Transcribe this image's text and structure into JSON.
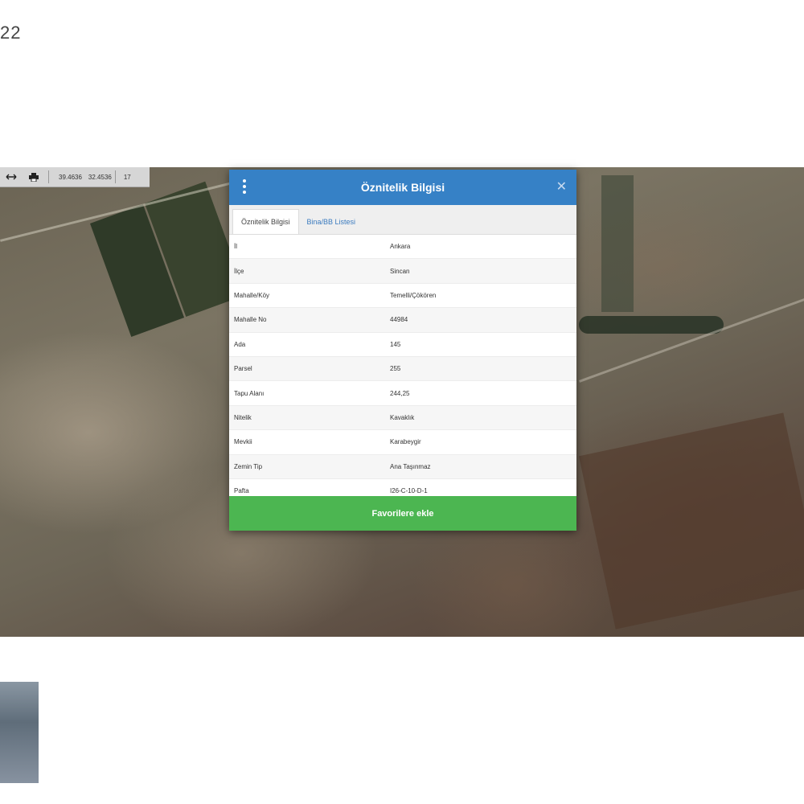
{
  "corner_label": "22",
  "toolbar": {
    "coord_1": "39.4636",
    "coord_2": "32.4536",
    "zoom": "17"
  },
  "dialog": {
    "title": "Öznitelik Bilgisi",
    "tabs": [
      {
        "label": "Öznitelik Bilgisi"
      },
      {
        "label": "Bina/BB Listesi"
      }
    ],
    "rows": [
      {
        "key": "İl",
        "value": "Ankara"
      },
      {
        "key": "İlçe",
        "value": "Sincan"
      },
      {
        "key": "Mahalle/Köy",
        "value": "Temelli/Çökören"
      },
      {
        "key": "Mahalle No",
        "value": "44984"
      },
      {
        "key": "Ada",
        "value": "145"
      },
      {
        "key": "Parsel",
        "value": "255"
      },
      {
        "key": "Tapu Alanı",
        "value": "244,25"
      },
      {
        "key": "Nitelik",
        "value": "Kavaklık"
      },
      {
        "key": "Mevkii",
        "value": "Karabeygir"
      },
      {
        "key": "Zemin Tip",
        "value": "Ana Taşınmaz"
      },
      {
        "key": "Pafta",
        "value": "I26-C-10-D-1"
      }
    ],
    "button_label": "Favorilere ekle"
  }
}
